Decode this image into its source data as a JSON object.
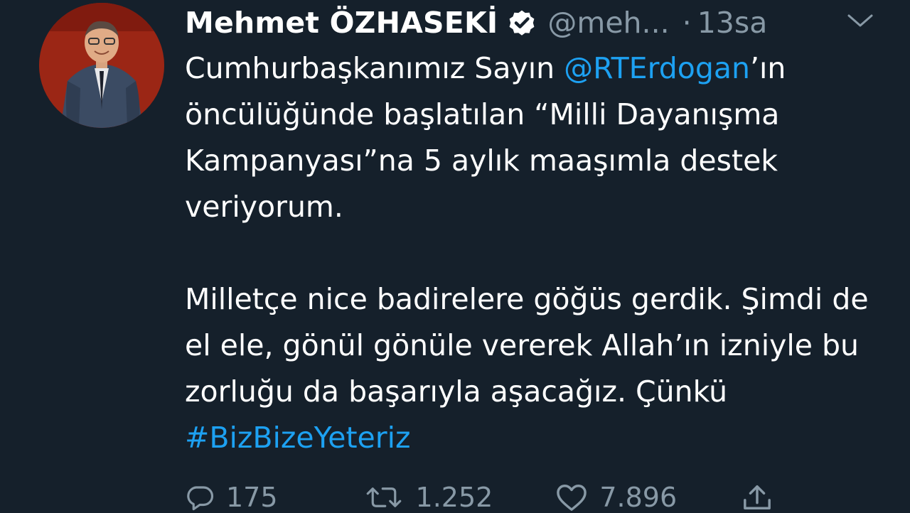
{
  "author": {
    "name": "Mehmet ÖZHASEKİ",
    "handle": "@meh...",
    "separator": "·",
    "time": "13sa"
  },
  "tweet": {
    "p1": {
      "before_mention": "Cumhurbaşkanımız Sayın ",
      "mention": "@RTErdogan",
      "after_mention": "’ın öncülüğünde başlatılan “Milli Dayanışma Kampanyası”na 5 aylık maaşımla destek veriyorum."
    },
    "p2": {
      "text": "Milletçe nice badirelere göğüs gerdik. Şimdi de el ele, gönül gönüle vererek Allah’ın izniyle bu zorluğu da başarıyla aşacağız. Çünkü ",
      "hashtag": "#BizBizeYeteriz"
    }
  },
  "actions": {
    "replies": "175",
    "retweets": "1.252",
    "likes": "7.896"
  },
  "colors": {
    "background": "#15202b",
    "link": "#1da1f2",
    "muted": "#8899a6"
  },
  "icons": [
    "verified-badge-icon",
    "chevron-down-icon",
    "reply-icon",
    "retweet-icon",
    "like-icon",
    "share-icon"
  ]
}
